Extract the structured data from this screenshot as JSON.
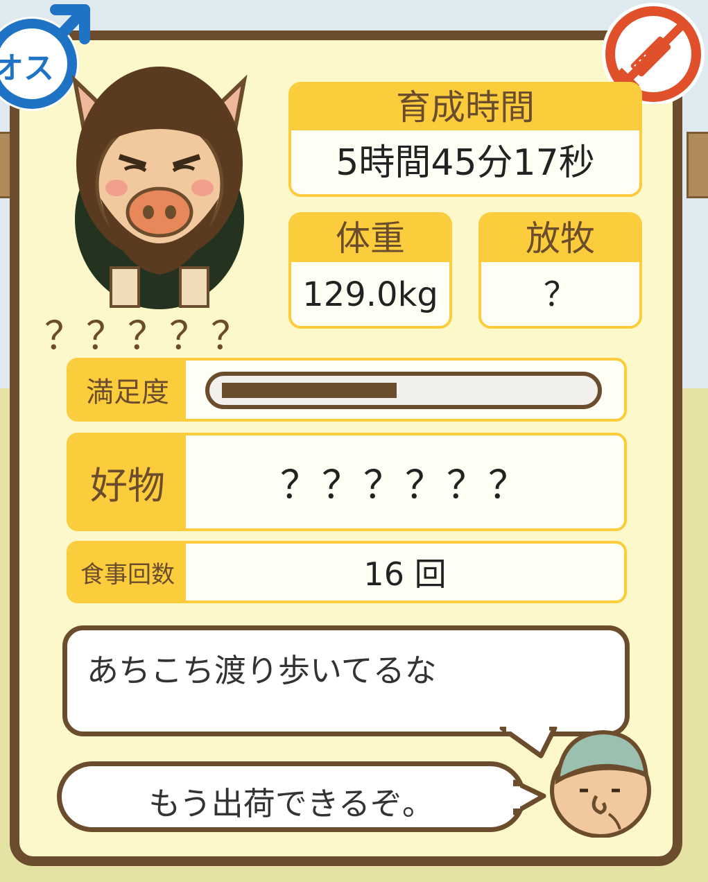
{
  "gender": {
    "label": "オス",
    "icon": "male-symbol-icon"
  },
  "medicine_icon": "no-syringe-icon",
  "pig": {
    "name": "？？？？？"
  },
  "stats": {
    "raising_time": {
      "label": "育成時間",
      "value": "5時間45分17秒"
    },
    "weight": {
      "label": "体重",
      "value": "129.0kg"
    },
    "grazing": {
      "label": "放牧",
      "value": "？"
    }
  },
  "satisfaction": {
    "label": "満足度",
    "level": 0.48
  },
  "favorite": {
    "label": "好物",
    "value": "？？？？？？"
  },
  "meals": {
    "label": "食事回数",
    "value": "16 回"
  },
  "comment": {
    "text": "あちこち渡り歩いてるな"
  },
  "farmer": {
    "text": "もう出荷できるぞ。"
  },
  "colors": {
    "accent": "#fbcc3c",
    "frame": "#6b4c2c",
    "panel": "#fdf8c9",
    "no_entry_red": "#e0502a"
  }
}
